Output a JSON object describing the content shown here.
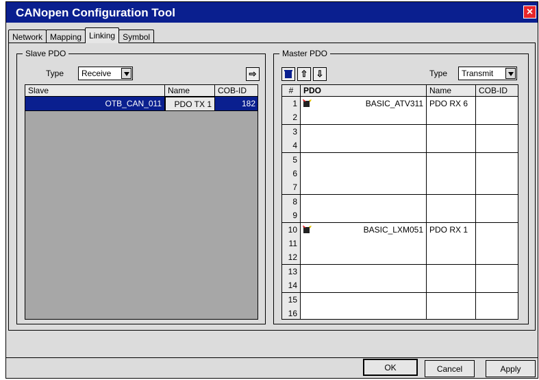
{
  "window": {
    "title": "CANopen Configuration Tool",
    "close": "×"
  },
  "tabs": [
    {
      "label": "Network"
    },
    {
      "label": "Mapping"
    },
    {
      "label": "Linking"
    },
    {
      "label": "Symbol"
    }
  ],
  "slave": {
    "group_label": "Slave PDO",
    "type_label": "Type",
    "type_value": "Receive",
    "transfer_icon": "⇨",
    "headers": {
      "slave": "Slave",
      "name": "Name",
      "cobid": "COB-ID"
    },
    "rows": [
      {
        "slave": "OTB_CAN_011",
        "name": "PDO TX 1",
        "cobid": "182"
      }
    ]
  },
  "master": {
    "group_label": "Master PDO",
    "type_label": "Type",
    "type_value": "Transmit",
    "headers": {
      "num": "#",
      "pdo": "PDO",
      "name": "Name",
      "cobid": "COB-ID"
    },
    "rows": [
      {
        "num": "1",
        "pdo": "BASIC_ATV311",
        "name": "PDO RX 6",
        "cobid": ""
      },
      {
        "num": "2",
        "pdo": "",
        "name": "",
        "cobid": ""
      },
      {
        "num": "3",
        "pdo": "",
        "name": "",
        "cobid": ""
      },
      {
        "num": "4",
        "pdo": "",
        "name": "",
        "cobid": ""
      },
      {
        "num": "5",
        "pdo": "",
        "name": "",
        "cobid": ""
      },
      {
        "num": "6",
        "pdo": "",
        "name": "",
        "cobid": ""
      },
      {
        "num": "7",
        "pdo": "",
        "name": "",
        "cobid": ""
      },
      {
        "num": "8",
        "pdo": "",
        "name": "",
        "cobid": ""
      },
      {
        "num": "9",
        "pdo": "",
        "name": "",
        "cobid": ""
      },
      {
        "num": "10",
        "pdo": "BASIC_LXM051",
        "name": "PDO RX 1",
        "cobid": ""
      },
      {
        "num": "11",
        "pdo": "",
        "name": "",
        "cobid": ""
      },
      {
        "num": "12",
        "pdo": "",
        "name": "",
        "cobid": ""
      },
      {
        "num": "13",
        "pdo": "",
        "name": "",
        "cobid": ""
      },
      {
        "num": "14",
        "pdo": "",
        "name": "",
        "cobid": ""
      },
      {
        "num": "15",
        "pdo": "",
        "name": "",
        "cobid": ""
      },
      {
        "num": "16",
        "pdo": "",
        "name": "",
        "cobid": ""
      }
    ]
  },
  "buttons": {
    "ok": "OK",
    "cancel": "Cancel",
    "apply": "Apply"
  },
  "colors": {
    "title_bar": "#0a1f8f",
    "selection": "#0a1f8f",
    "close": "#e8262a"
  }
}
